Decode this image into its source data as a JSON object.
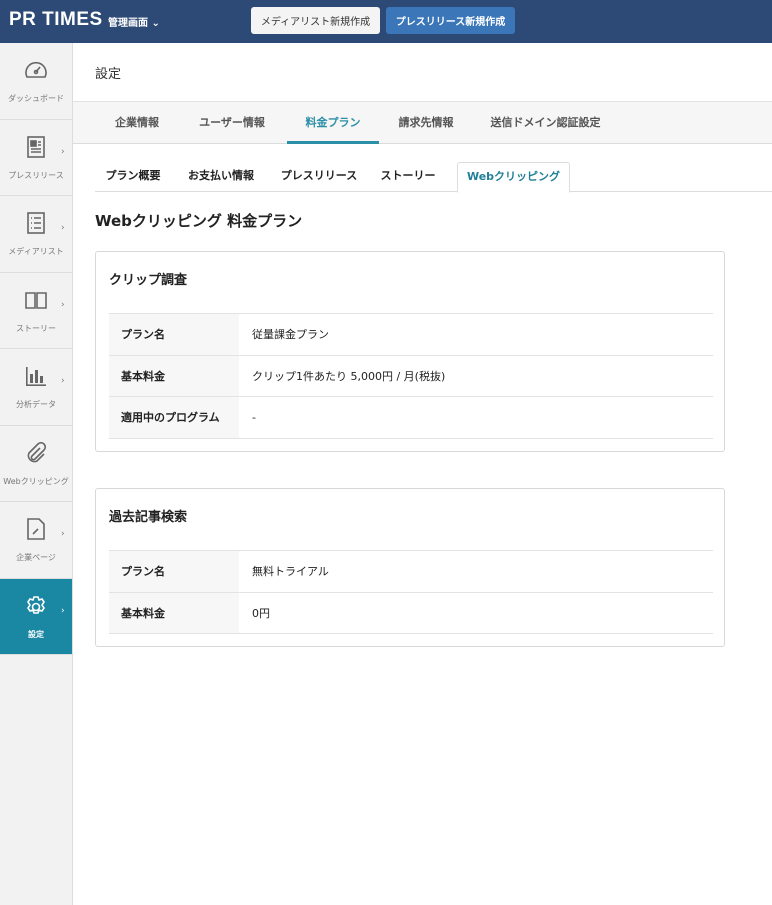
{
  "header": {
    "logo": "PR TIMES",
    "admin_label": "管理画面",
    "media_list_button": "メディアリスト新規作成",
    "press_release_button": "プレスリリース新規作成"
  },
  "sidebar": {
    "items": [
      {
        "label": "ダッシュボード",
        "icon": "dashboard-icon",
        "chevron": false
      },
      {
        "label": "プレスリリース",
        "icon": "newspaper-icon",
        "chevron": true
      },
      {
        "label": "メディアリスト",
        "icon": "list-icon",
        "chevron": true
      },
      {
        "label": "ストーリー",
        "icon": "book-icon",
        "chevron": true
      },
      {
        "label": "分析データ",
        "icon": "bar-chart-icon",
        "chevron": true
      },
      {
        "label": "Webクリッピング",
        "icon": "paperclip-icon",
        "chevron": false
      },
      {
        "label": "企業ページ",
        "icon": "edit-document-icon",
        "chevron": true
      },
      {
        "label": "設定",
        "icon": "gear-icon",
        "chevron": true,
        "active": true
      }
    ]
  },
  "page": {
    "title": "設定"
  },
  "tabs": [
    {
      "label": "企業情報"
    },
    {
      "label": "ユーザー情報"
    },
    {
      "label": "料金プラン",
      "active": true
    },
    {
      "label": "請求先情報"
    },
    {
      "label": "送信ドメイン認証設定"
    }
  ],
  "subtabs": [
    {
      "label": "プラン概要"
    },
    {
      "label": "お支払い情報"
    },
    {
      "label": "プレスリリース"
    },
    {
      "label": "ストーリー"
    },
    {
      "label": "Webクリッピング",
      "active": true
    }
  ],
  "heading": "Webクリッピング 料金プラン",
  "cards": [
    {
      "title": "クリップ調査",
      "rows": [
        {
          "key": "プラン名",
          "value": "従量課金プラン"
        },
        {
          "key": "基本料金",
          "value": "クリップ1件あたり 5,000円 / 月(税抜)"
        },
        {
          "key": "適用中のプログラム",
          "value": "-"
        }
      ]
    },
    {
      "title": "過去記事検索",
      "rows": [
        {
          "key": "プラン名",
          "value": "無料トライアル"
        },
        {
          "key": "基本料金",
          "value": "0円"
        }
      ]
    }
  ],
  "colors": {
    "header": "#2c4a75",
    "accent": "#1a87a3",
    "primary_button": "#3a76b8"
  }
}
